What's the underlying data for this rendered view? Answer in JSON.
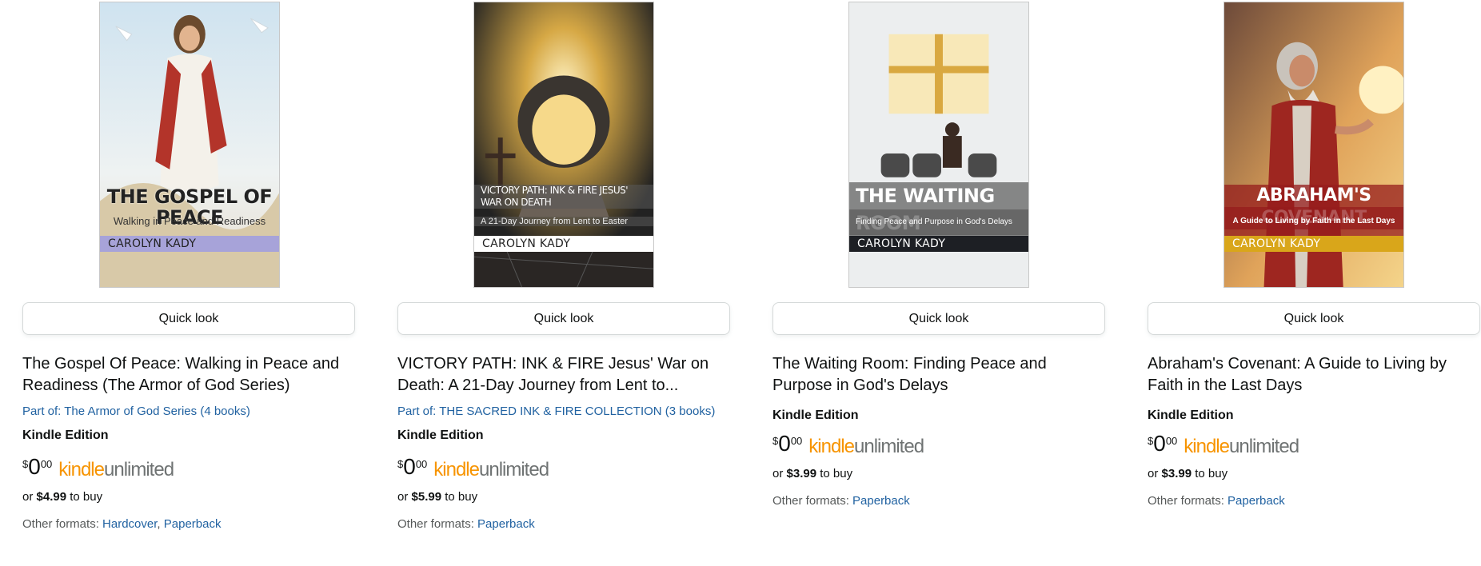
{
  "colors": {
    "link": "#2162a1",
    "kindle": "#f79400",
    "unlimited": "#6f7373",
    "text": "#0f1111",
    "muted": "#565959"
  },
  "products": [
    {
      "cover": {
        "title": "THE GOSPEL OF PEACE",
        "subtitle": "Walking in Peace and Readiness",
        "author": "CAROLYN KADY"
      },
      "quick_look": "Quick look",
      "title": "The Gospel Of Peace: Walking in Peace and Readiness (The Armor of God Series)",
      "series": "Part of: The Armor of God Series (4 books)",
      "edition": "Kindle Edition",
      "price": {
        "symbol": "$",
        "whole": "0",
        "fraction": "00"
      },
      "kindle_unlimited": {
        "kindle": "kindle",
        "unlimited": "unlimited"
      },
      "buy": {
        "prefix": "or",
        "price": "$4.99",
        "suffix": "to buy"
      },
      "formats": {
        "label": "Other formats:",
        "items": [
          "Hardcover",
          "Paperback"
        ],
        "separator": ","
      }
    },
    {
      "cover": {
        "title": "VICTORY PATH: INK & FIRE JESUS' WAR ON DEATH",
        "subtitle": "A 21-Day Journey from Lent to Easter",
        "author": "CAROLYN KADY"
      },
      "quick_look": "Quick look",
      "title": "VICTORY PATH: INK & FIRE Jesus' War on Death: A 21-Day Journey from Lent to...",
      "series": "Part of: THE SACRED INK & FIRE COLLECTION (3 books)",
      "edition": "Kindle Edition",
      "price": {
        "symbol": "$",
        "whole": "0",
        "fraction": "00"
      },
      "kindle_unlimited": {
        "kindle": "kindle",
        "unlimited": "unlimited"
      },
      "buy": {
        "prefix": "or",
        "price": "$5.99",
        "suffix": "to buy"
      },
      "formats": {
        "label": "Other formats:",
        "items": [
          "Paperback"
        ]
      }
    },
    {
      "cover": {
        "title": "THE WAITING ROOM",
        "subtitle": "Finding Peace and Purpose in God's Delays",
        "author": "CAROLYN KADY"
      },
      "quick_look": "Quick look",
      "title": "The Waiting Room: Finding Peace and Purpose in God's Delays",
      "edition": "Kindle Edition",
      "price": {
        "symbol": "$",
        "whole": "0",
        "fraction": "00"
      },
      "kindle_unlimited": {
        "kindle": "kindle",
        "unlimited": "unlimited"
      },
      "buy": {
        "prefix": "or",
        "price": "$3.99",
        "suffix": "to buy"
      },
      "formats": {
        "label": "Other formats:",
        "items": [
          "Paperback"
        ]
      }
    },
    {
      "cover": {
        "title": "ABRAHAM'S COVENANT",
        "subtitle": "A Guide to Living by Faith in the Last Days",
        "author": "CAROLYN KADY"
      },
      "quick_look": "Quick look",
      "title": "Abraham's Covenant: A Guide to Living by Faith in the Last Days",
      "edition": "Kindle Edition",
      "price": {
        "symbol": "$",
        "whole": "0",
        "fraction": "00"
      },
      "kindle_unlimited": {
        "kindle": "kindle",
        "unlimited": "unlimited"
      },
      "buy": {
        "prefix": "or",
        "price": "$3.99",
        "suffix": "to buy"
      },
      "formats": {
        "label": "Other formats:",
        "items": [
          "Paperback"
        ]
      }
    }
  ]
}
